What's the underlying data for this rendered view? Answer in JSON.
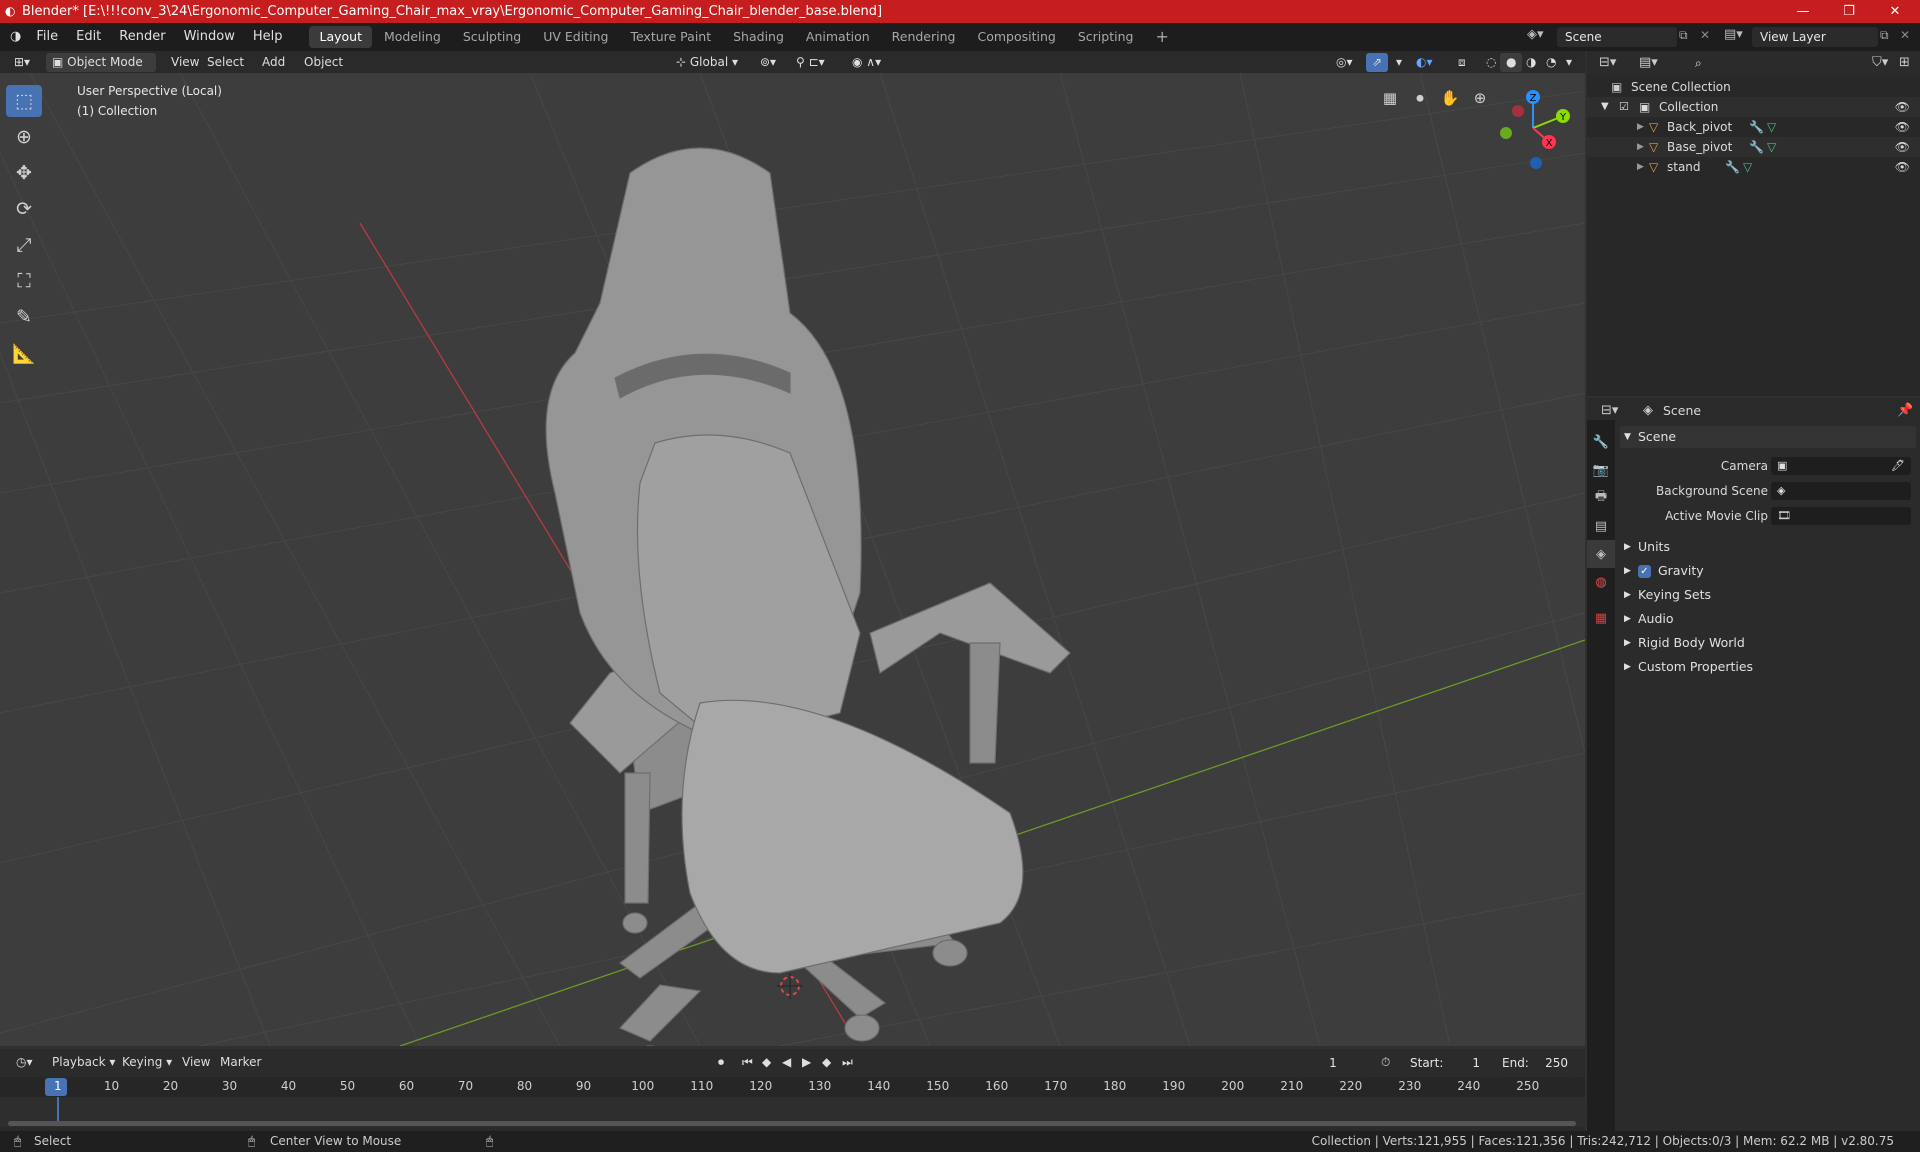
{
  "title_bar": {
    "title": "Blender* [E:\\!!!conv_3\\24\\Ergonomic_Computer_Gaming_Chair_max_vray\\Ergonomic_Computer_Gaming_Chair_blender_base.blend]"
  },
  "top_menu": [
    "File",
    "Edit",
    "Render",
    "Window",
    "Help"
  ],
  "workspaces": [
    "Layout",
    "Modeling",
    "Sculpting",
    "UV Editing",
    "Texture Paint",
    "Shading",
    "Animation",
    "Rendering",
    "Compositing",
    "Scripting"
  ],
  "active_workspace": "Layout",
  "scene_field": "Scene",
  "view_layer_field": "View Layer",
  "viewport_header": {
    "mode": "Object Mode",
    "menus": [
      "View",
      "Select",
      "Add",
      "Object"
    ],
    "transform_orientation": "Global"
  },
  "viewport_info": {
    "line1": "User Perspective (Local)",
    "line2": "(1) Collection"
  },
  "gizmo": {
    "z": "Z",
    "y": "Y",
    "x": "X"
  },
  "outliner": {
    "search_placeholder": "",
    "root": "Scene Collection",
    "collection": "Collection",
    "objects": [
      "Back_pivot",
      "Base_pivot",
      "stand"
    ]
  },
  "properties": {
    "header": "Scene",
    "panel_title": "Scene",
    "fields": [
      {
        "label": "Camera"
      },
      {
        "label": "Background Scene"
      },
      {
        "label": "Active Movie Clip"
      }
    ],
    "sections": [
      "Units",
      "Gravity",
      "Keying Sets",
      "Audio",
      "Rigid Body World",
      "Custom Properties"
    ],
    "gravity_checked": true
  },
  "timeline": {
    "menus": [
      "Playback",
      "Keying",
      "View",
      "Marker"
    ],
    "current_frame": "1",
    "start_label": "Start:",
    "start_value": "1",
    "end_label": "End:",
    "end_value": "250",
    "ruler_marks": [
      "1",
      "10",
      "20",
      "30",
      "40",
      "50",
      "60",
      "70",
      "80",
      "90",
      "100",
      "110",
      "120",
      "130",
      "140",
      "150",
      "160",
      "170",
      "180",
      "190",
      "200",
      "210",
      "220",
      "230",
      "240",
      "250"
    ]
  },
  "status_bar": {
    "left_hint": "Select",
    "mid_hint": "Center View to Mouse",
    "stats": "Collection | Verts:121,955 | Faces:121,356 | Tris:242,712 | Objects:0/3 | Mem: 62.2 MB | v2.80.75"
  },
  "colors": {
    "title_bar": "#c61e1e",
    "accent_blue": "#4772b3",
    "axis_red": "#ff3352",
    "axis_green": "#8bdc00",
    "axis_blue": "#2890ff"
  }
}
